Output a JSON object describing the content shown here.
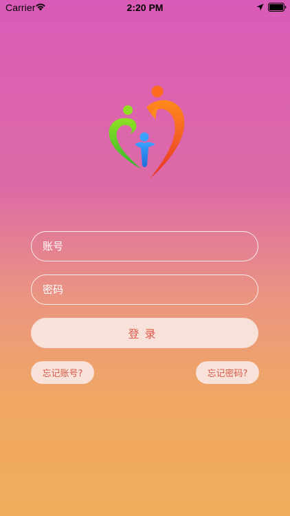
{
  "status_bar": {
    "carrier": "Carrier",
    "time": "2:20 PM"
  },
  "login": {
    "account_placeholder": "账号",
    "password_placeholder": "密码",
    "login_label": "登录",
    "forgot_account_label": "忘记账号?",
    "forgot_password_label": "忘记密码?"
  },
  "icons": {
    "wifi": "wifi-icon",
    "location": "location-arrow-icon",
    "battery": "battery-icon",
    "logo": "family-heart-logo"
  },
  "colors": {
    "gradient_top": "#d95bb8",
    "gradient_bottom": "#f2ad5e",
    "button_bg": "#f8e1d8",
    "button_text": "#e05a4e"
  }
}
